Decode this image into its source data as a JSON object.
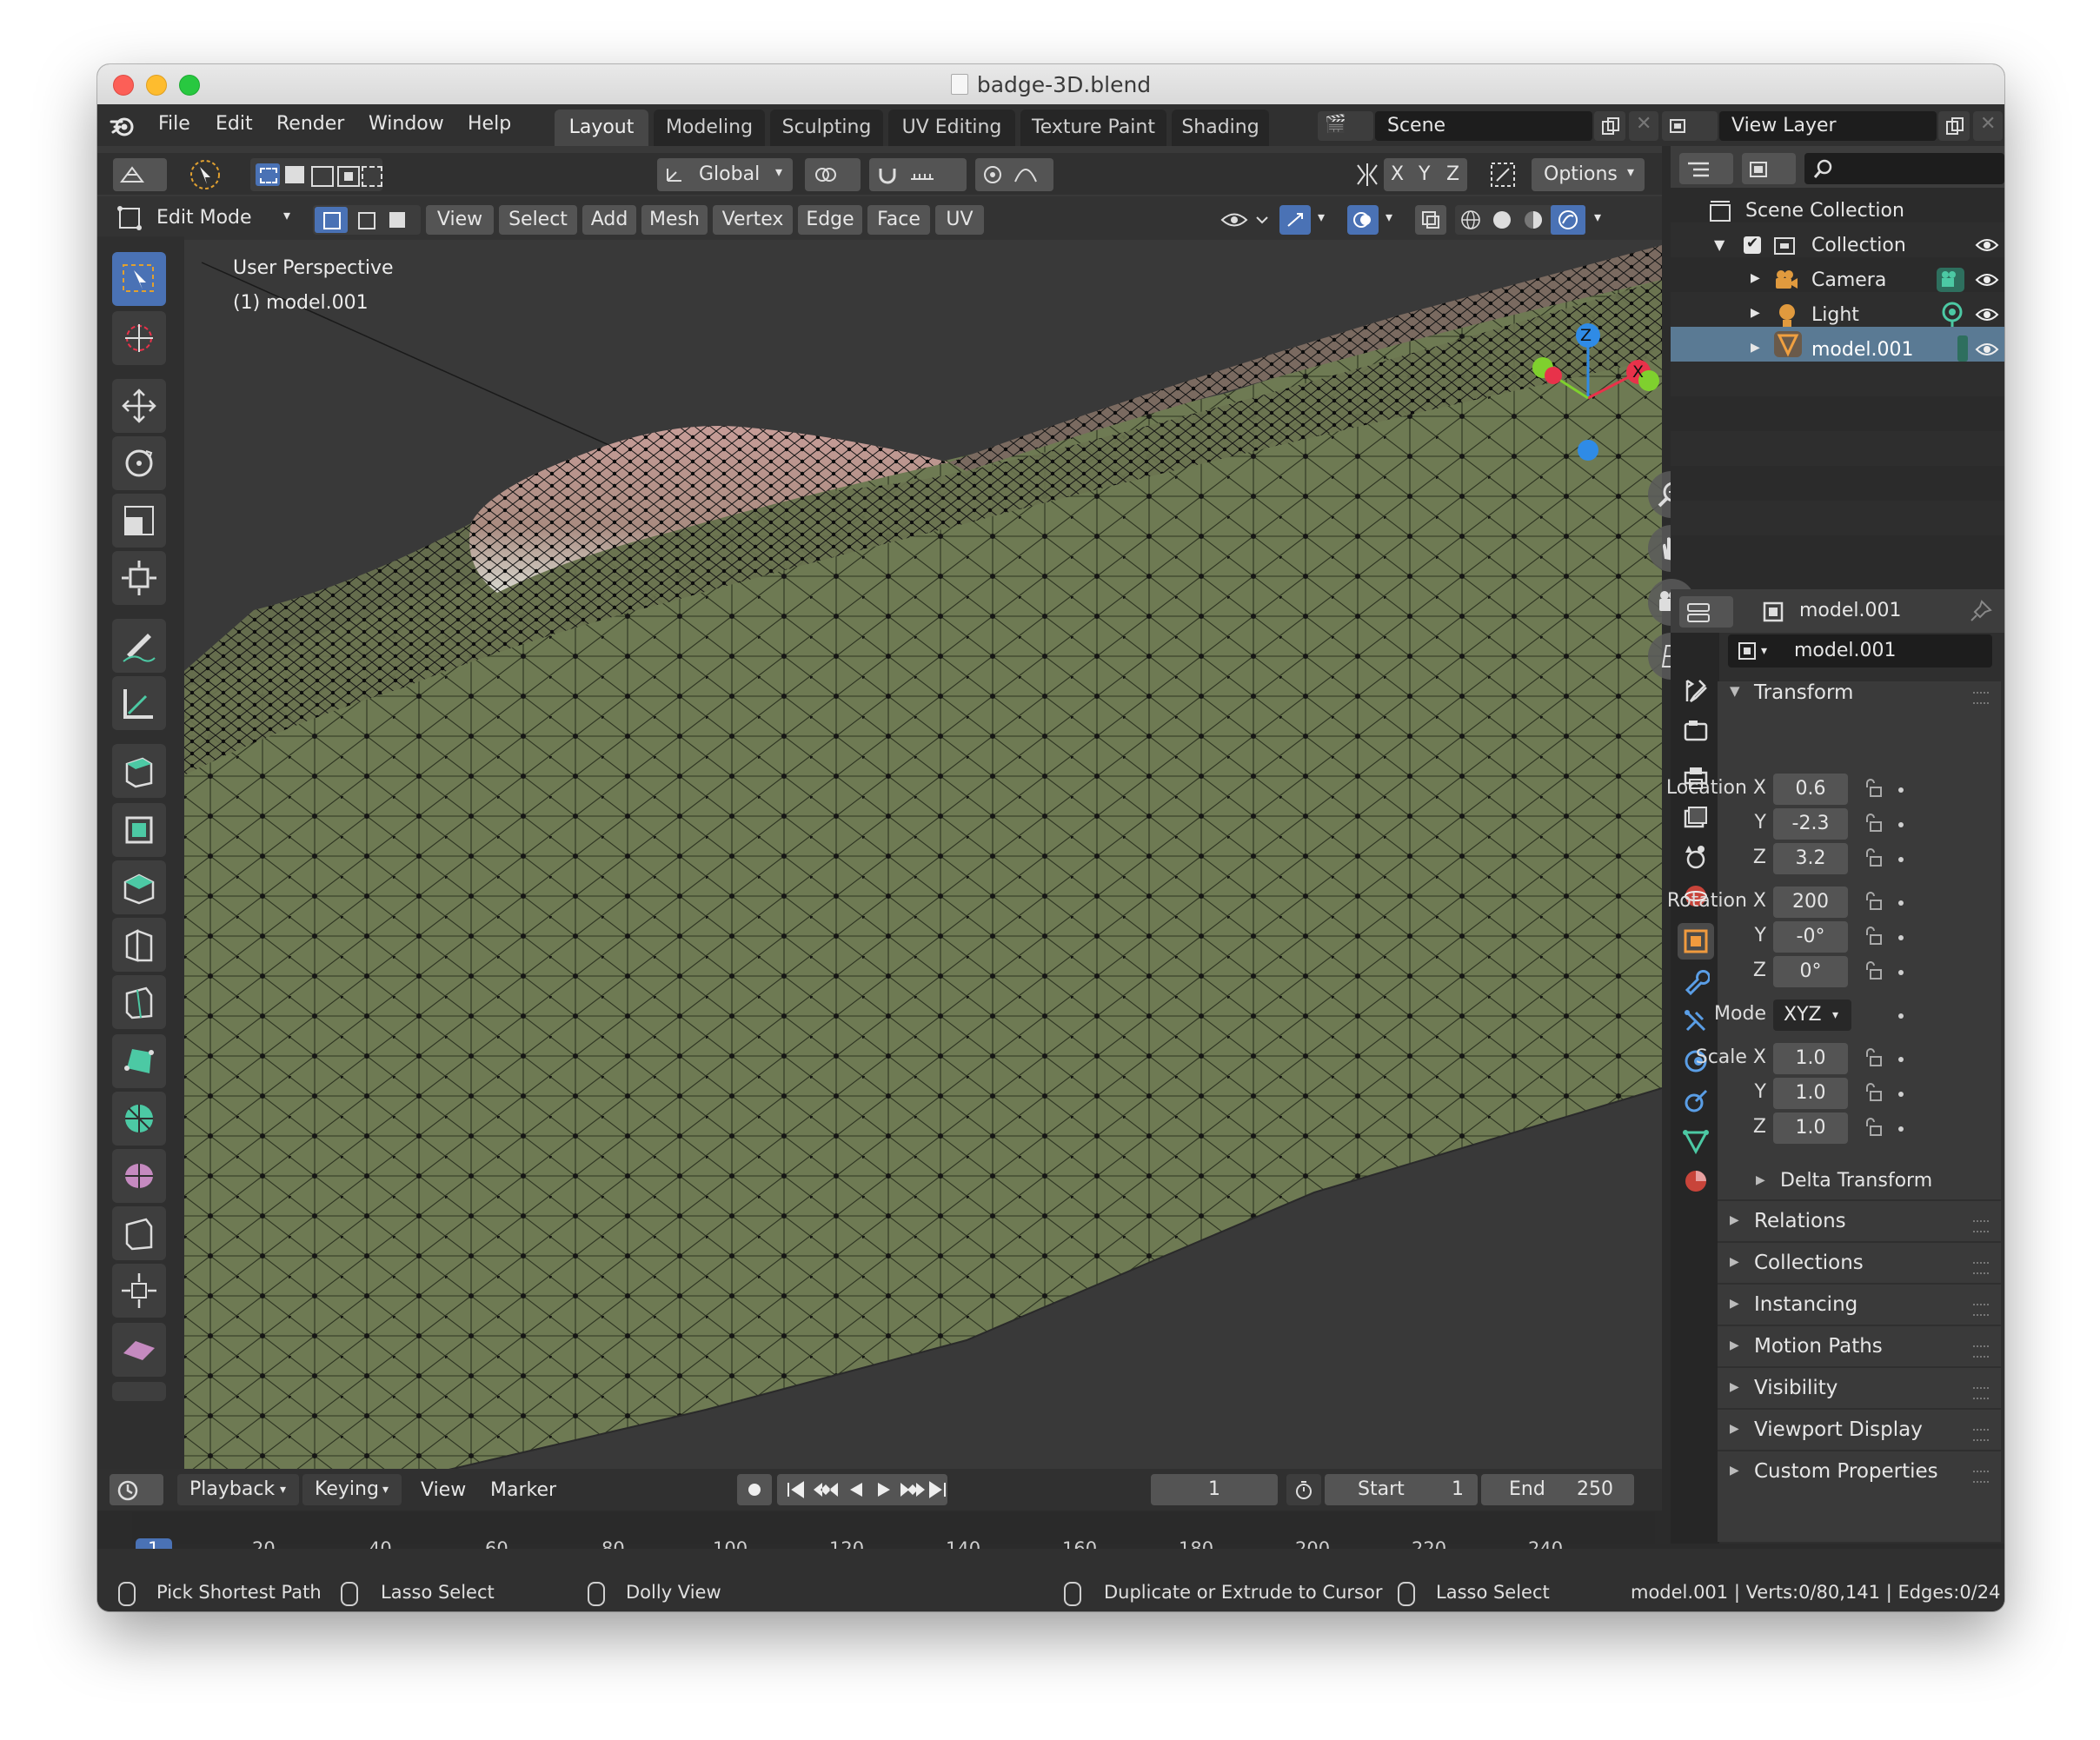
{
  "window": {
    "title": "badge-3D.blend"
  },
  "menu": {
    "items": [
      "File",
      "Edit",
      "Render",
      "Window",
      "Help"
    ]
  },
  "workspaces": {
    "tabs": [
      "Layout",
      "Modeling",
      "Sculpting",
      "UV Editing",
      "Texture Paint",
      "Shading"
    ],
    "active": "Layout"
  },
  "scene": {
    "label": "Scene"
  },
  "view_layer": {
    "label": "View Layer"
  },
  "viewport_header": {
    "orientation": "Global",
    "axes": [
      "X",
      "Y",
      "Z"
    ],
    "options": "Options",
    "mode": "Edit Mode",
    "menus": [
      "View",
      "Select",
      "Add",
      "Mesh",
      "Vertex",
      "Edge",
      "Face",
      "UV"
    ]
  },
  "viewport": {
    "info_line1": "User Perspective",
    "info_line2": "(1) model.001",
    "gizmo": {
      "z": "Z",
      "x": "X"
    }
  },
  "outliner": {
    "root": "Scene Collection",
    "collection": "Collection",
    "items": [
      "Camera",
      "Light",
      "model.001"
    ],
    "selected": "model.001"
  },
  "properties": {
    "object_name": "model.001",
    "name_field": "model.001",
    "transform_label": "Transform",
    "location": {
      "label": "Location X",
      "x": "0.6",
      "y": "-2.3",
      "z": "3.2"
    },
    "rotation": {
      "label": "Rotation X",
      "x": "200",
      "y": "-0°",
      "z": "0°"
    },
    "axis_y": "Y",
    "axis_z": "Z",
    "mode_label": "Mode",
    "mode_value": "XYZ",
    "scale": {
      "label": "Scale X",
      "x": "1.0",
      "y": "1.0",
      "z": "1.0"
    },
    "delta_transform": "Delta Transform",
    "sections": [
      "Relations",
      "Collections",
      "Instancing",
      "Motion Paths",
      "Visibility",
      "Viewport Display",
      "Custom Properties"
    ]
  },
  "timeline": {
    "menus": [
      "Playback",
      "Keying",
      "View",
      "Marker"
    ],
    "current_frame": "1",
    "start_label": "Start",
    "start_value": "1",
    "end_label": "End",
    "end_value": "250",
    "ticks": [
      "1",
      "20",
      "40",
      "60",
      "80",
      "100",
      "120",
      "140",
      "160",
      "180",
      "200",
      "220",
      "240"
    ]
  },
  "statusbar": {
    "items": [
      "Pick Shortest Path",
      "Lasso Select",
      "Dolly View",
      "Duplicate or Extrude to Cursor",
      "Lasso Select"
    ],
    "stats": "model.001 | Verts:0/80,141 | Edges:0/24"
  },
  "colors": {
    "accent": "#4a72b5",
    "mesh_green": "#6e7a53",
    "mesh_pink": "#c9a29a",
    "gizmo_x": "#e8324a",
    "gizmo_y": "#7fd02e",
    "gizmo_z": "#2f8be6"
  }
}
